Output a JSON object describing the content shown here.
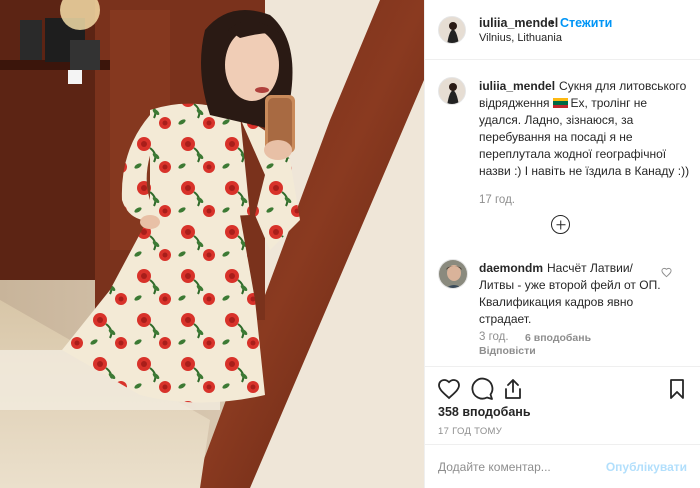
{
  "post": {
    "author": "iuliia_mendel",
    "follow_label": "Стежити",
    "separator": "•",
    "location": "Vilnius, Lithuania",
    "more_icon": "more-horizontal-icon"
  },
  "caption": {
    "username": "iuliia_mendel",
    "text_before_flag": "Сукня для литовського відрядження",
    "flag_colors": [
      "#FDB913",
      "#006A44",
      "#C1272D"
    ],
    "text_after_flag": "Ех, тролінг не удался. Ладно, зізнаюся, за перебування на посаді я не переплутала жодної географічної назви :) І навіть не їздила в Канаду :))",
    "time": "17 год."
  },
  "load_more_icon": "plus-circle-icon",
  "reply": {
    "username": "daemondm",
    "text": "Насчёт Латвии/Литвы - уже второй фейл от ОП. Квалификация кадров явно страдает.",
    "time": "3 год.",
    "likes": "6 вподобань",
    "reply_label": "Відповісти",
    "heart_icon": "heart-outline-icon"
  },
  "actions": {
    "icons": [
      "heart-icon",
      "comment-icon",
      "share-icon",
      "bookmark-icon"
    ],
    "likes_count": "358 вподобань",
    "date": "17 ГОД ТОМУ"
  },
  "comment_box": {
    "placeholder": "Додайте коментар...",
    "publish_label": "Опублікувати",
    "publish_color": "#b2dffc"
  },
  "colors": {
    "accent": "#0095f6",
    "text": "#262626",
    "muted": "#8e8e8e",
    "border": "#efefef"
  }
}
